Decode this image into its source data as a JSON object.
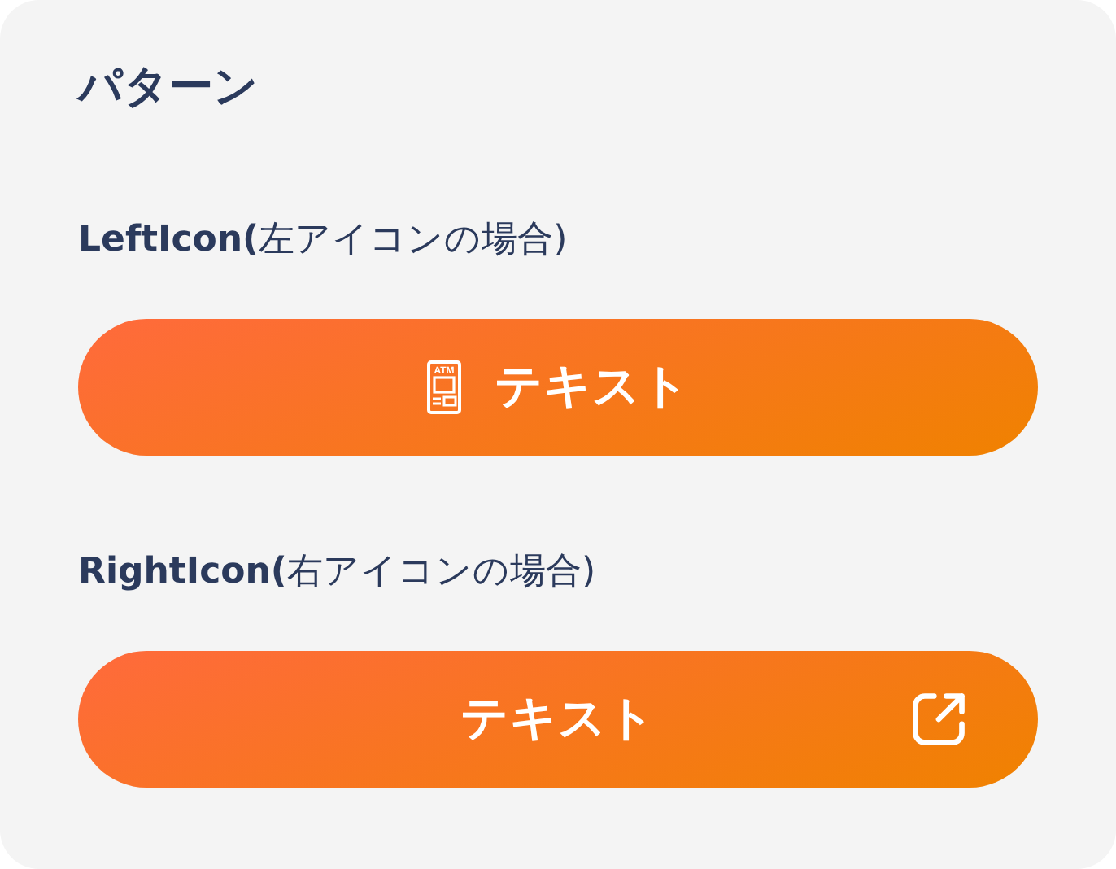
{
  "title": "パターン",
  "patterns": [
    {
      "label": "**LeftIcon(**左アイコンの場合)",
      "button": {
        "text": "テキスト",
        "kind": "left_icon",
        "icon_label": "ATM"
      }
    },
    {
      "label": "**RightIcon(**右アイコンの場合)",
      "button": {
        "text": "テキスト",
        "kind": "right_icon"
      }
    }
  ]
}
